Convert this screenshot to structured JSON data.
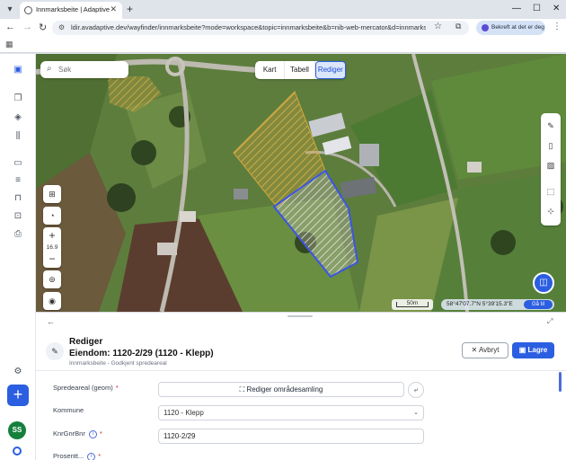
{
  "browser": {
    "tab_title": "Innmarksbeite | Adaptive",
    "url": "ldir.avadaptive.dev/wayfinder/innmarksbeite?mode=workspace&topic=innmarksbeite&b=nib-web-mercator&d=innmarksbeite-...",
    "confirm_chip_label": "Bekreft at det er deg"
  },
  "map": {
    "search_placeholder": "Søk",
    "modes": [
      "Kart",
      "Tabell",
      "Rediger"
    ],
    "active_mode": "Rediger",
    "zoom_level": "16.9",
    "scale_label": "50m",
    "coordinates": "58°47'07.7\"N 5°39'15.3\"E",
    "goto_label": "Gå til"
  },
  "panel": {
    "title": "Rediger",
    "subtitle": "Eiendom: 1120-2/29 (1120 - Klepp)",
    "caption": "Innmarksbeite - Godkjent spredeareal",
    "cancel_label": "Avbryt",
    "save_label": "Lagre",
    "fields": {
      "spredeareal_label": "Spredeareal (geom)",
      "spredeareal_button": "Rediger områdesamling",
      "kommune_label": "Kommune",
      "kommune_value": "1120 - Klepp",
      "knr_label": "KnrGnrBnr",
      "knr_value": "1120-2/29",
      "next_label": "Prosentt..."
    }
  },
  "rail": {
    "avatar_initials": "SS"
  },
  "colors": {
    "accent": "#2b5ee0",
    "selected_parcel": "#3b55e6",
    "approved_parcel": "#d8b04a"
  }
}
